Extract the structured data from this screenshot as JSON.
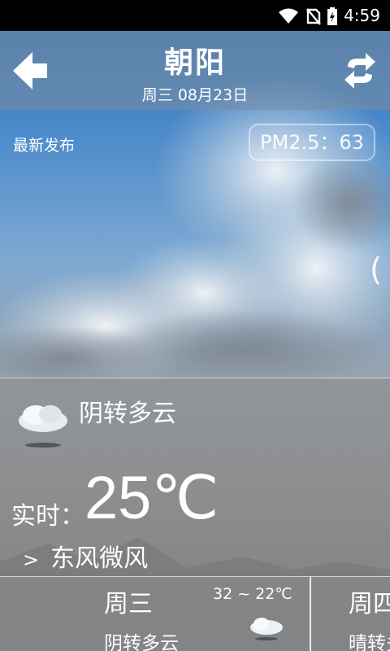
{
  "status_bar": {
    "time": "4:59",
    "icons": [
      "wifi-icon",
      "no-sim-icon",
      "battery-charging-icon"
    ]
  },
  "header": {
    "back_icon": "back-arrow-icon",
    "refresh_icon": "refresh-icon",
    "city": "朝阳",
    "date": "周三 08月23日"
  },
  "publish_label": "最新发布",
  "pm25": "PM2.5：63",
  "side_arrow": "(",
  "current": {
    "icon": "cloudy-icon",
    "condition": "阴转多云",
    "now_label": "实时：",
    "temperature": "25℃",
    "wind_arrow": ">",
    "wind": "东风微风"
  },
  "forecast": [
    {
      "day": "周三",
      "range": "32 ~ 22℃",
      "condition": "阴转多云",
      "icon": "cloudy-icon"
    },
    {
      "day": "周四",
      "condition": "晴转多"
    }
  ]
}
